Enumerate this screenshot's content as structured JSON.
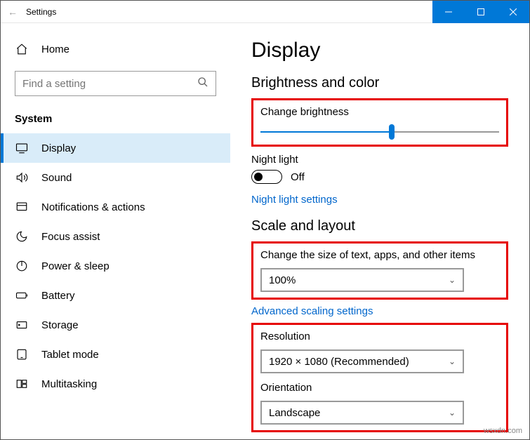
{
  "window": {
    "title": "Settings"
  },
  "sidebar": {
    "home": "Home",
    "search_placeholder": "Find a setting",
    "section": "System",
    "items": [
      {
        "label": "Display"
      },
      {
        "label": "Sound"
      },
      {
        "label": "Notifications & actions"
      },
      {
        "label": "Focus assist"
      },
      {
        "label": "Power & sleep"
      },
      {
        "label": "Battery"
      },
      {
        "label": "Storage"
      },
      {
        "label": "Tablet mode"
      },
      {
        "label": "Multitasking"
      }
    ]
  },
  "content": {
    "title": "Display",
    "brightness_heading": "Brightness and color",
    "brightness_label": "Change brightness",
    "brightness_value": 55,
    "night_light_label": "Night light",
    "night_light_state": "Off",
    "night_light_link": "Night light settings",
    "scale_heading": "Scale and layout",
    "scale_label": "Change the size of text, apps, and other items",
    "scale_value": "100%",
    "scaling_link": "Advanced scaling settings",
    "resolution_label": "Resolution",
    "resolution_value": "1920 × 1080 (Recommended)",
    "orientation_label": "Orientation",
    "orientation_value": "Landscape"
  },
  "watermark": "wsxdn.com"
}
